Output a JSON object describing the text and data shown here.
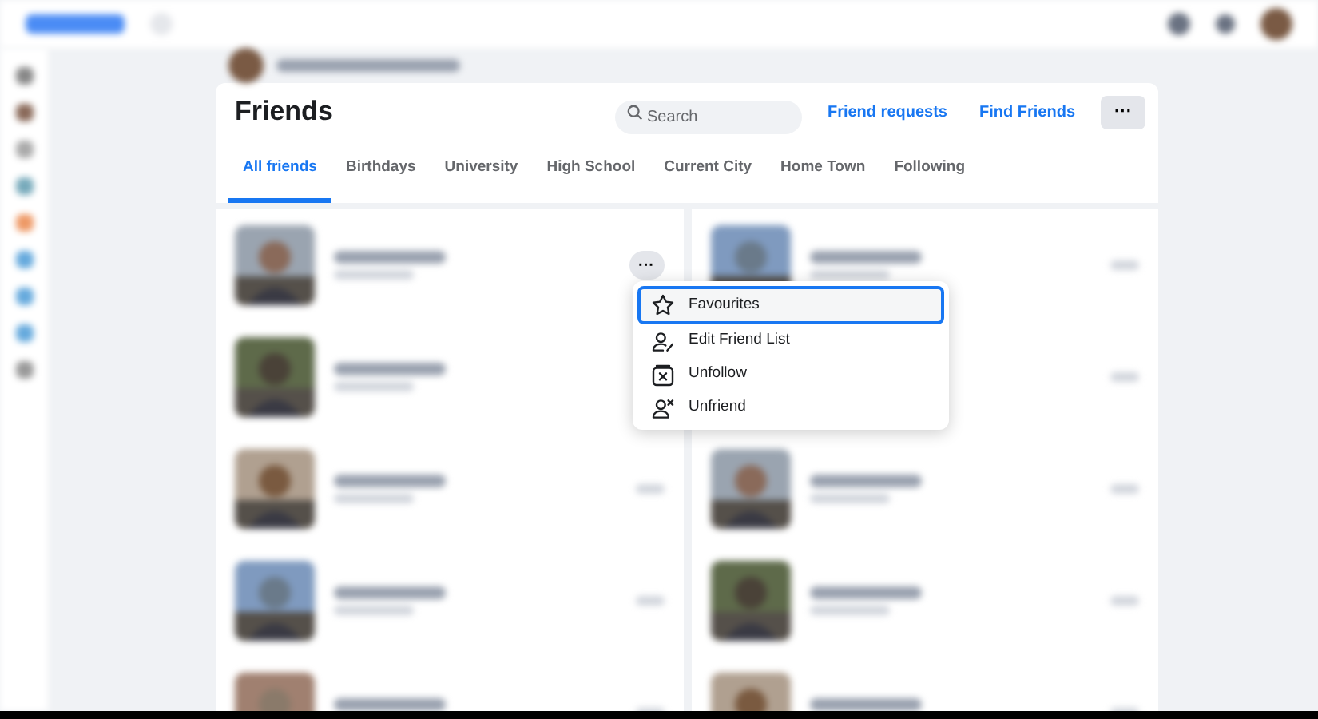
{
  "friends_panel": {
    "title": "Friends",
    "search": {
      "placeholder": "Search"
    },
    "links": [
      "Friend requests",
      "Find Friends"
    ],
    "more_button": "···"
  },
  "tabs": [
    {
      "label": "All friends",
      "selected": true
    },
    {
      "label": "Birthdays",
      "selected": false
    },
    {
      "label": "University",
      "selected": false
    },
    {
      "label": "High School",
      "selected": false
    },
    {
      "label": "Current City",
      "selected": false
    },
    {
      "label": "Home Town",
      "selected": false
    },
    {
      "label": "Following",
      "selected": false
    }
  ],
  "card_menu_button": "···",
  "menu": [
    {
      "label": "Favourites",
      "kind": "star",
      "selected": true
    },
    {
      "label": "Edit Friend List",
      "kind": "edit",
      "selected": false
    },
    {
      "label": "Unfollow",
      "kind": "unfollow",
      "selected": false
    },
    {
      "label": "Unfriend",
      "kind": "unfriend",
      "selected": false
    }
  ],
  "friend_cards": [
    {
      "kind": "picture"
    },
    {
      "kind": "picture"
    },
    {
      "kind": "picture"
    },
    {
      "kind": "covered"
    },
    {
      "kind": "picture"
    },
    {
      "kind": "picture"
    },
    {
      "kind": "picture"
    },
    {
      "kind": "picture"
    },
    {
      "kind": "picture"
    },
    {
      "kind": "picture"
    }
  ]
}
